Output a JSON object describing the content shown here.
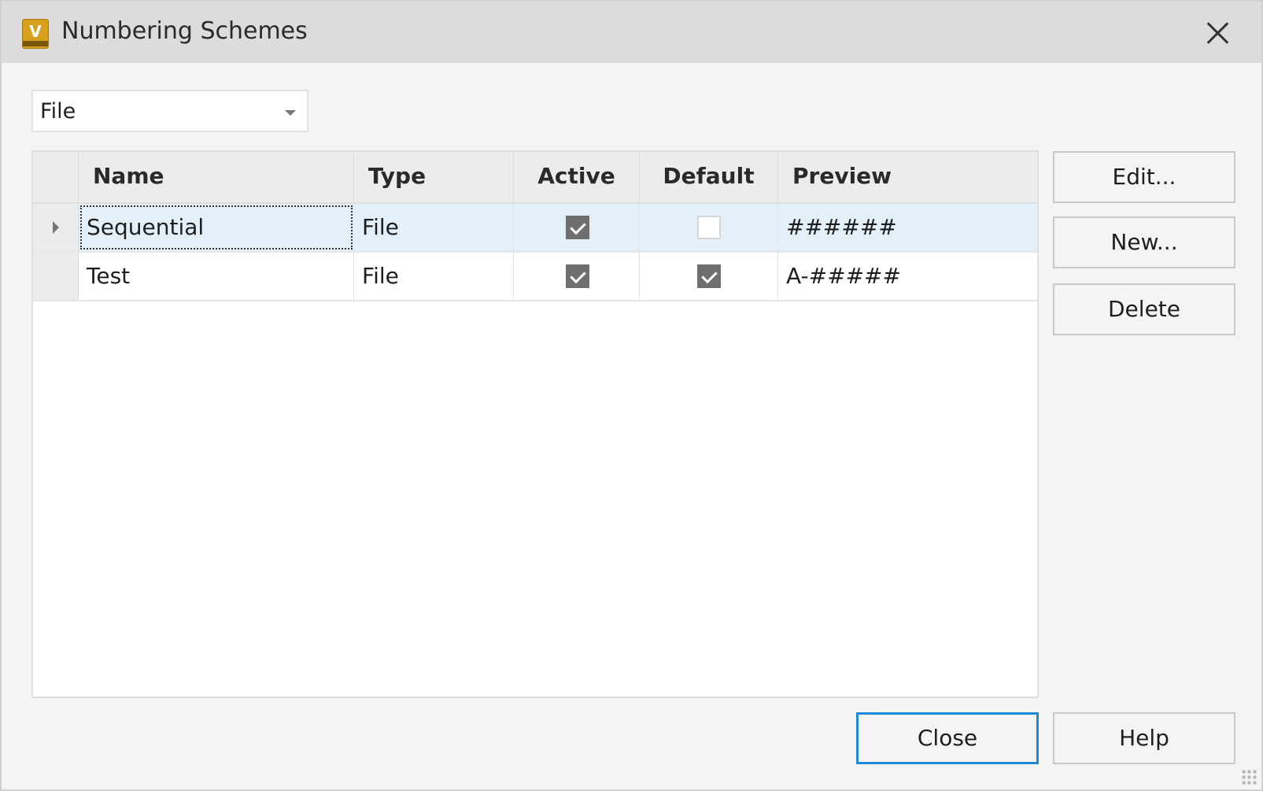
{
  "window": {
    "title": "Numbering Schemes",
    "app_icon_letter": "V"
  },
  "filter": {
    "selected": "File"
  },
  "table": {
    "columns": [
      "Name",
      "Type",
      "Active",
      "Default",
      "Preview"
    ],
    "rows": [
      {
        "name": "Sequential",
        "type": "File",
        "active": true,
        "default": false,
        "preview": "######",
        "selected": true
      },
      {
        "name": "Test",
        "type": "File",
        "active": true,
        "default": true,
        "preview": "A-#####",
        "selected": false
      }
    ]
  },
  "side_buttons": {
    "edit": "Edit...",
    "new": "New...",
    "delete": "Delete"
  },
  "footer_buttons": {
    "close": "Close",
    "help": "Help"
  },
  "colors": {
    "titlebar": "#dcdcdc",
    "selection": "#e3f0fa",
    "focus_border": "#1e8ad6"
  }
}
